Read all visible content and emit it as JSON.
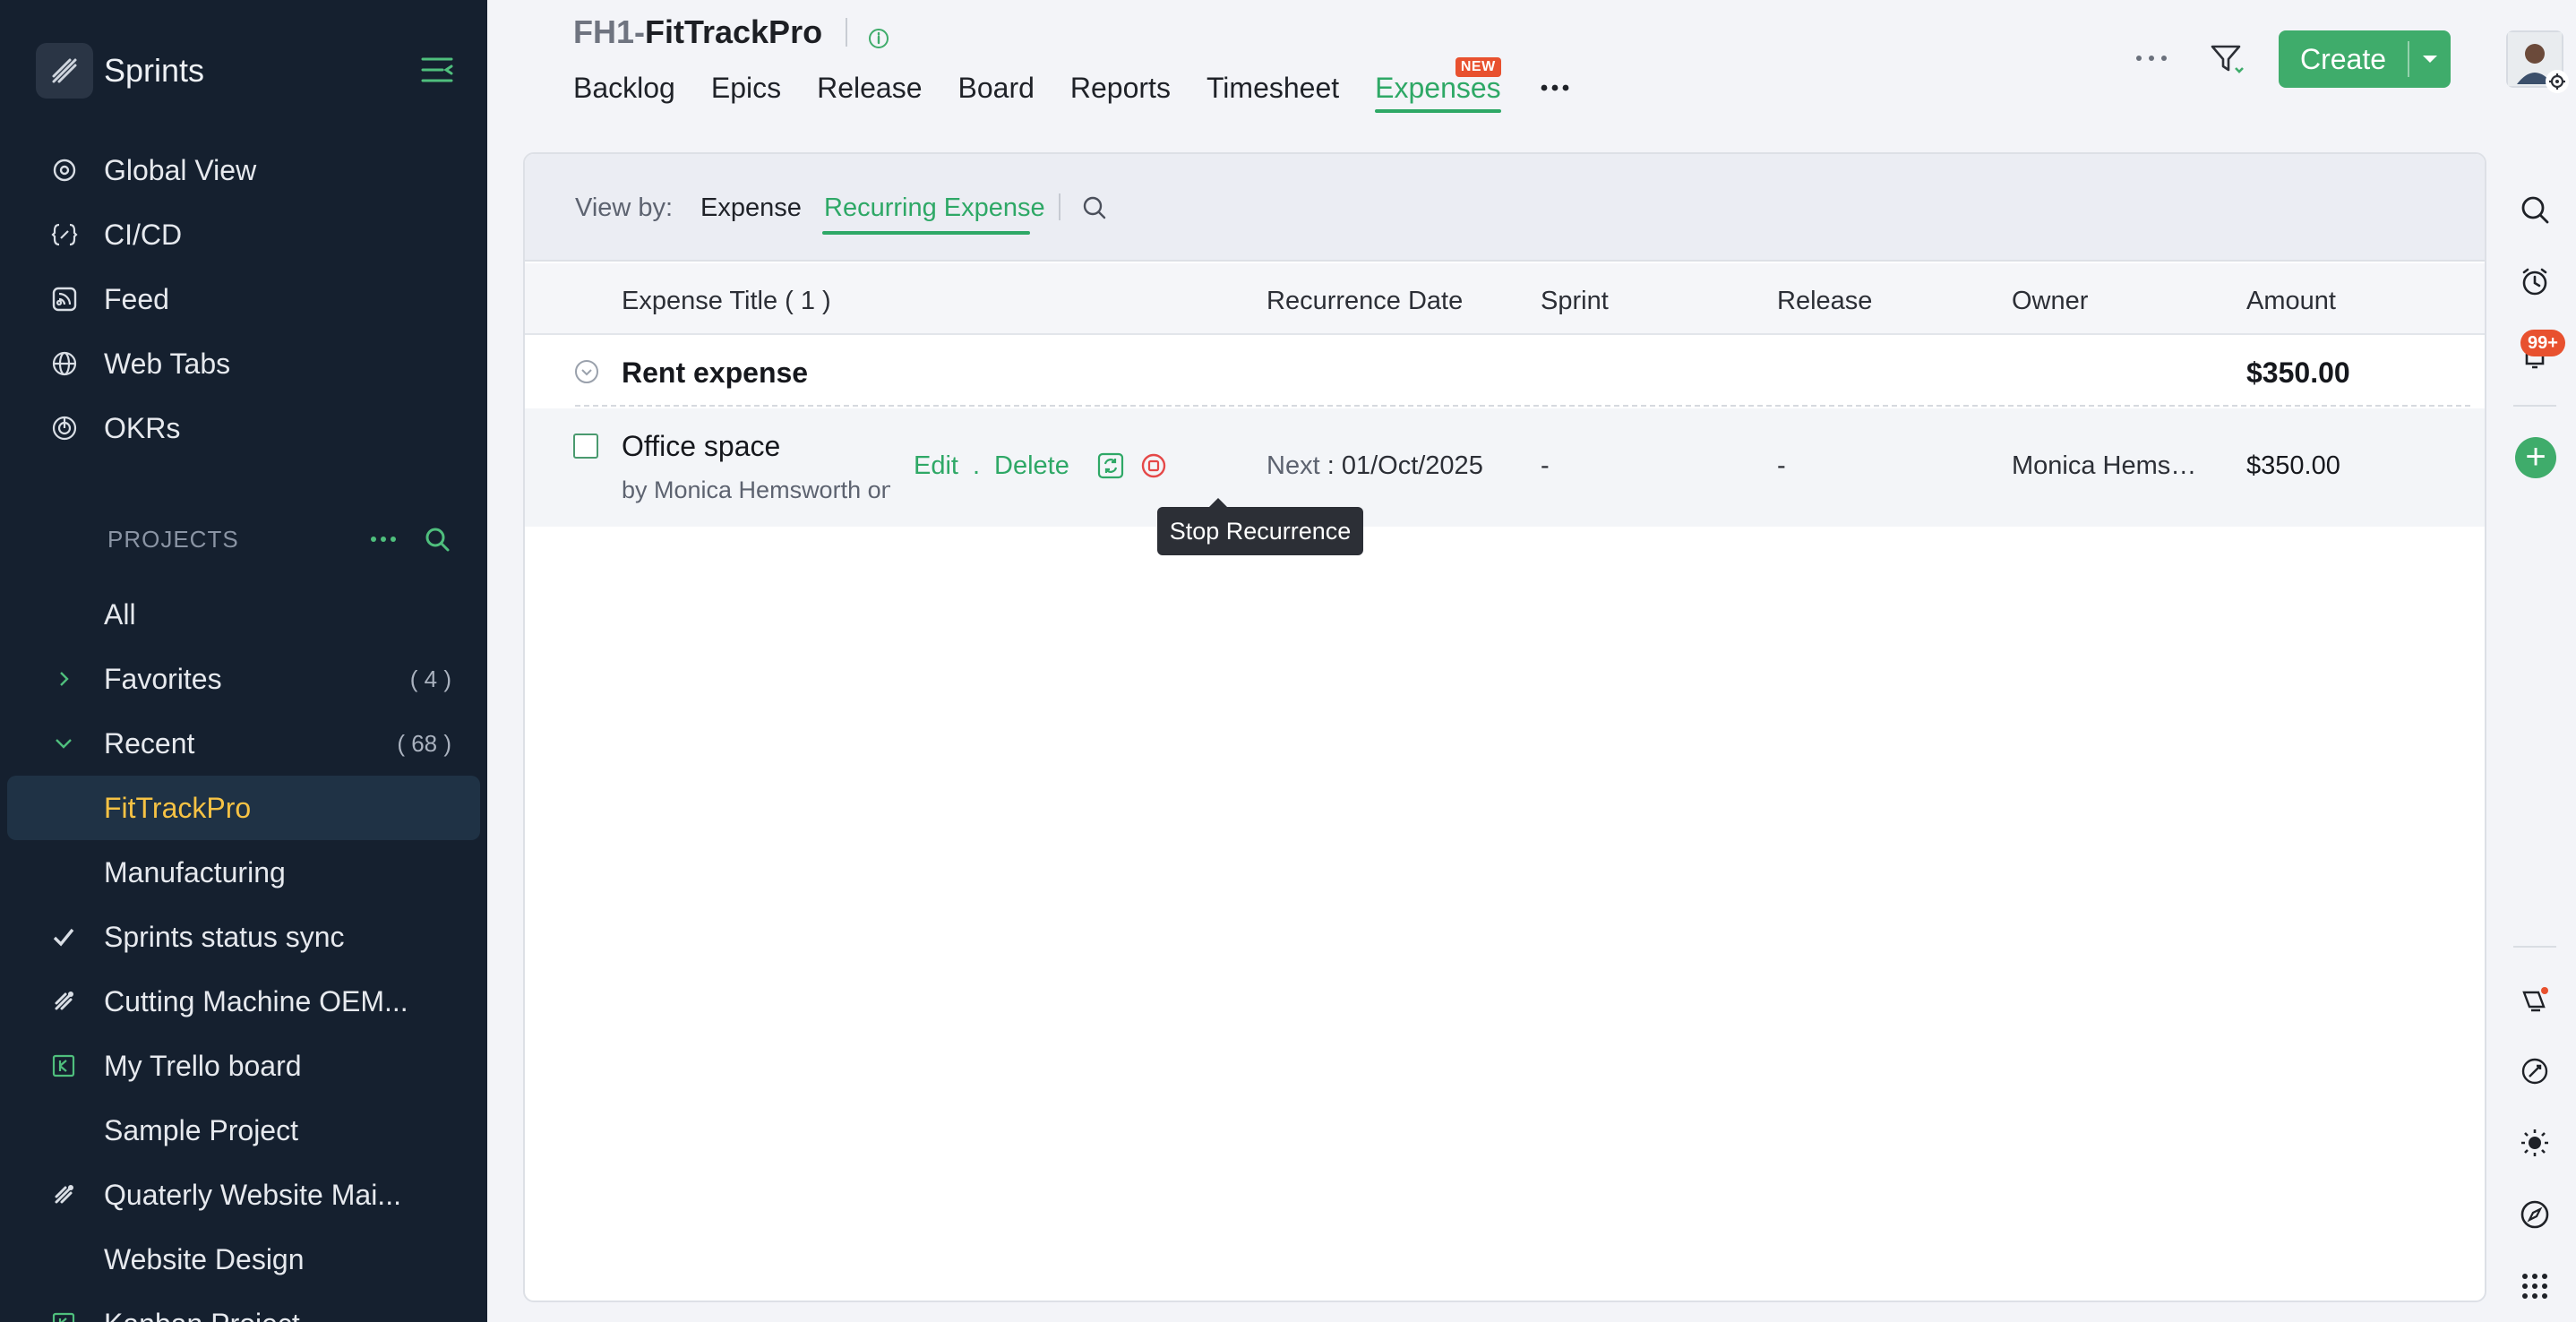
{
  "colors": {
    "sidebar_bg": "#15202f",
    "accent_green": "#2ea866",
    "active_project": "#f6c244",
    "badge_red": "#e8512f",
    "stop_red": "#e54848"
  },
  "sidebar": {
    "brand": "Sprints",
    "nav": [
      {
        "label": "Global View",
        "icon": "global-view-icon"
      },
      {
        "label": "CI/CD",
        "icon": "ci-cd-icon"
      },
      {
        "label": "Feed",
        "icon": "feed-icon"
      },
      {
        "label": "Web Tabs",
        "icon": "globe-icon"
      },
      {
        "label": "OKRs",
        "icon": "okr-icon"
      }
    ],
    "projects_heading": "PROJECTS",
    "projects": [
      {
        "label": "All"
      },
      {
        "label": "Favorites",
        "count": "( 4 )"
      },
      {
        "label": "Recent",
        "count": "( 68 )"
      },
      {
        "label": "FitTrackPro"
      },
      {
        "label": "Manufacturing"
      },
      {
        "label": "Sprints status sync"
      },
      {
        "label": "Cutting Machine OEM..."
      },
      {
        "label": "My Trello board"
      },
      {
        "label": "Sample Project"
      },
      {
        "label": "Quaterly Website Mai..."
      },
      {
        "label": "Website Design"
      },
      {
        "label": "Kanban Project"
      }
    ]
  },
  "header": {
    "project_prefix": "FH1-",
    "project_name": "FitTrackPro",
    "tabs": [
      "Backlog",
      "Epics",
      "Release",
      "Board",
      "Reports",
      "Timesheet",
      "Expenses"
    ],
    "new_badge": "NEW",
    "create_label": "Create"
  },
  "viewbar": {
    "label": "View by:",
    "options": [
      "Expense",
      "Recurring Expense"
    ]
  },
  "table": {
    "columns": [
      "Expense Title ( 1 )",
      "Recurrence Date",
      "Sprint",
      "Release",
      "Owner",
      "Amount"
    ],
    "group": {
      "title": "Rent expense",
      "amount": "$350.00"
    },
    "rows": [
      {
        "title": "Office space",
        "by": "by Monica Hemsworth on",
        "edit": "Edit",
        "dot": ".",
        "delete": "Delete",
        "next_label": "Next",
        "next_date": ": 01/Oct/2025",
        "sprint": "-",
        "release": "-",
        "owner": "Monica Hemsw...",
        "amount": "$350.00"
      }
    ]
  },
  "tooltip": "Stop Recurrence",
  "notifications_badge": "99+"
}
